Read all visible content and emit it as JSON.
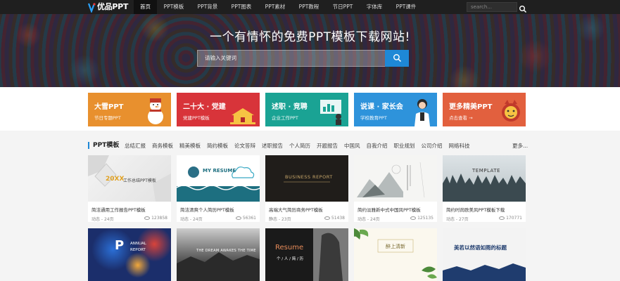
{
  "nav": {
    "logo": "优品PPT",
    "items": [
      "首页",
      "PPT模板",
      "PPT背景",
      "PPT图表",
      "PPT素材",
      "PPT教程",
      "节日PPT",
      "字体库",
      "PPT课件"
    ],
    "search_placeholder": "search..."
  },
  "hero": {
    "title": "一个有情怀的免费PPT模板下载网站!",
    "search_placeholder": "请输入关键词"
  },
  "banners": [
    {
      "title": "大雪PPT",
      "subtitle": "节日专题PPT",
      "color": "#e8902e"
    },
    {
      "title": "二十大 · 党建",
      "subtitle": "党建PPT模板",
      "color": "#d8343a"
    },
    {
      "title": "述职 · 竞聘",
      "subtitle": "企业工作PPT",
      "color": "#1aa394"
    },
    {
      "title": "说课 · 家长会",
      "subtitle": "学校教育PPT",
      "color": "#2e93db"
    },
    {
      "title": "更多精美PPT",
      "subtitle": "点击查看 →",
      "color": "#e2603e"
    }
  ],
  "category": {
    "title": "PPT模板",
    "items": [
      "总结汇报",
      "商务模板",
      "精美模板",
      "简约模板",
      "论文答辩",
      "述职报告",
      "个人简历",
      "开题报告",
      "中国风",
      "自我介绍",
      "职业规划",
      "公司介绍",
      "网络科技"
    ],
    "more": "更多..."
  },
  "cards": [
    {
      "title": "简洁通用工作报告PPT模板",
      "meta": "动态 - 24页",
      "views": "123858",
      "thumb_text": "20XX",
      "thumb_sub": "工作总结PPT模板"
    },
    {
      "title": "简洁清爽个人简历PPT模板",
      "meta": "动态 - 24页",
      "views": "56361",
      "thumb_text": "MY RESUME"
    },
    {
      "title": "高端大气简历商务PPT模板",
      "meta": "静态 - 23页",
      "views": "51438",
      "thumb_text": "BUSINESS REPORT"
    },
    {
      "title": "简约淡雅新中式中国风PPT模板",
      "meta": "动态 - 24页",
      "views": "125135"
    },
    {
      "title": "简约时尚欧美风PPT模板下载",
      "meta": "动态 - 27页",
      "views": "170771",
      "thumb_text": "TEMPLATE"
    }
  ],
  "cards_row2": [
    {
      "thumb_text": "P",
      "thumb_sub": "ANNUAL REPORT"
    },
    {
      "thumb_text": "THE DREAM AWAKES THE TIME"
    },
    {
      "thumb_text": "Resume",
      "thumb_sub": "个 / 人 / 简 / 历"
    },
    {
      "thumb_text": "醉上清新"
    },
    {
      "thumb_text": "美若以然语如雨的标题"
    }
  ]
}
